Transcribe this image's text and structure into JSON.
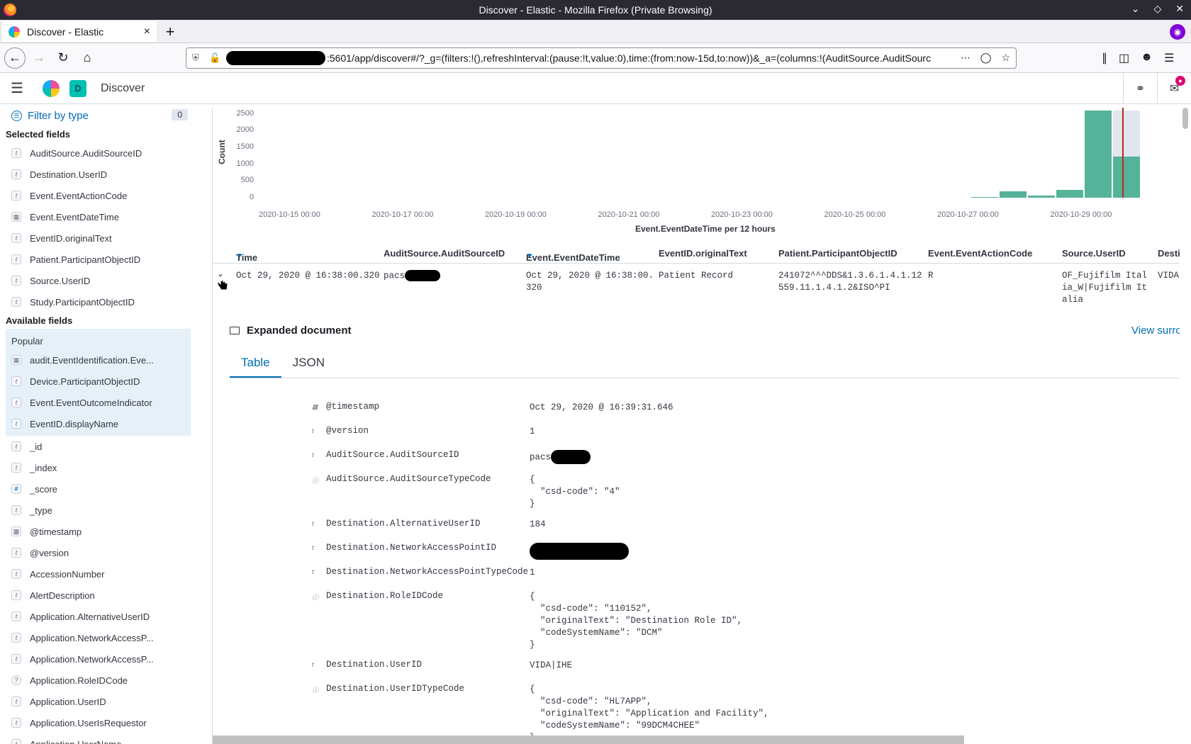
{
  "window": {
    "title": "Discover - Elastic - Mozilla Firefox (Private Browsing)"
  },
  "tab": {
    "label": "Discover - Elastic",
    "close": "×",
    "new": "+"
  },
  "url": {
    "text": ":5601/app/discover#/?_g=(filters:!(),refreshInterval:(pause:!t,value:0),time:(from:now-15d,to:now))&_a=(columns:!(AuditSource.AuditSourc"
  },
  "kibana": {
    "breadcrumb": "Discover",
    "space_letter": "D"
  },
  "sidebar": {
    "filter_label": "Filter by type",
    "filter_count": "0",
    "selected_title": "Selected fields",
    "selected": [
      {
        "type": "t",
        "name": "AuditSource.AuditSourceID"
      },
      {
        "type": "t",
        "name": "Destination.UserID"
      },
      {
        "type": "t",
        "name": "Event.EventActionCode"
      },
      {
        "type": "date",
        "name": "Event.EventDateTime"
      },
      {
        "type": "t",
        "name": "EventID.originalText"
      },
      {
        "type": "t",
        "name": "Patient.ParticipantObjectID"
      },
      {
        "type": "t",
        "name": "Source.UserID"
      },
      {
        "type": "t",
        "name": "Study.ParticipantObjectID"
      }
    ],
    "available_title": "Available fields",
    "popular_label": "Popular",
    "popular": [
      {
        "type": "date",
        "name": "audit.EventIdentification.Eve..."
      },
      {
        "type": "t",
        "name": "Device.ParticipantObjectID"
      },
      {
        "type": "t",
        "name": "Event.EventOutcomeIndicator"
      },
      {
        "type": "t",
        "name": "EventID.displayName"
      }
    ],
    "available": [
      {
        "type": "t",
        "name": "_id"
      },
      {
        "type": "t",
        "name": "_index"
      },
      {
        "type": "num",
        "name": "_score"
      },
      {
        "type": "t",
        "name": "_type"
      },
      {
        "type": "date",
        "name": "@timestamp"
      },
      {
        "type": "t",
        "name": "@version"
      },
      {
        "type": "t",
        "name": "AccessionNumber"
      },
      {
        "type": "t",
        "name": "AlertDescription"
      },
      {
        "type": "t",
        "name": "Application.AlternativeUserID"
      },
      {
        "type": "t",
        "name": "Application.NetworkAccessP..."
      },
      {
        "type": "t",
        "name": "Application.NetworkAccessP..."
      },
      {
        "type": "obj",
        "name": "Application.RoleIDCode"
      },
      {
        "type": "t",
        "name": "Application.UserID"
      },
      {
        "type": "t",
        "name": "Application.UserIsRequestor"
      },
      {
        "type": "t",
        "name": "Application.UserName"
      }
    ]
  },
  "chart_data": {
    "type": "bar",
    "ylabel": "Count",
    "xlabel": "Event.EventDateTime per 12 hours",
    "yticks": [
      "2500",
      "2000",
      "1500",
      "1000",
      "500",
      "0"
    ],
    "xticks": [
      "2020-10-15 00:00",
      "2020-10-17 00:00",
      "2020-10-19 00:00",
      "2020-10-21 00:00",
      "2020-10-23 00:00",
      "2020-10-25 00:00",
      "2020-10-27 00:00",
      "2020-10-29 00:00"
    ],
    "ylim": [
      0,
      2600
    ],
    "categories": [
      "2020-10-27 00:00",
      "2020-10-27 12:00",
      "2020-10-28 00:00",
      "2020-10-28 12:00",
      "2020-10-29 00:00",
      "2020-10-29 12:00"
    ],
    "values": [
      30,
      180,
      70,
      230,
      2600,
      1230
    ]
  },
  "table": {
    "columns": [
      "Time",
      "AuditSource.AuditSourceID",
      "Event.EventDateTime",
      "EventID.originalText",
      "Patient.ParticipantObjectID",
      "Event.EventActionCode",
      "Source.UserID",
      "Desti"
    ],
    "row": {
      "time": "Oct 29, 2020 @ 16:38:00.320",
      "audit_source": "pacs",
      "event_datetime_1": "Oct 29, 2020 @ 16:38:00.",
      "event_datetime_2": "320",
      "event_id_text": "Patient Record",
      "patient_1": "241072^^^DDS&1.3.6.1.4.1.12",
      "patient_2": "559.11.1.4.1.2&ISO^PI",
      "action_code": "R",
      "source_1": "OF_Fujifilm Ital",
      "source_2": "ia_W|Fujifilm It",
      "source_3": "alia",
      "dest": "VIDA"
    }
  },
  "expanded": {
    "title": "Expanded document",
    "view_surrounding": "View surro",
    "tabs": [
      "Table",
      "JSON"
    ],
    "rows": [
      {
        "icon": "date",
        "key": "@timestamp",
        "val": "Oct 29, 2020 @ 16:39:31.646"
      },
      {
        "icon": "t",
        "key": "@version",
        "val": "1"
      },
      {
        "icon": "t",
        "key": "AuditSource.AuditSourceID",
        "val": "pacs"
      },
      {
        "icon": "obj",
        "key": "AuditSource.AuditSourceTypeCode",
        "val": "{\n  \"csd-code\": \"4\"\n}"
      },
      {
        "icon": "t",
        "key": "Destination.AlternativeUserID",
        "val": "184"
      },
      {
        "icon": "t",
        "key": "Destination.NetworkAccessPointID",
        "val": ""
      },
      {
        "icon": "t",
        "key": "Destination.NetworkAccessPointTypeCode",
        "val": "1"
      },
      {
        "icon": "obj",
        "key": "Destination.RoleIDCode",
        "val": "{\n  \"csd-code\": \"110152\",\n  \"originalText\": \"Destination Role ID\",\n  \"codeSystemName\": \"DCM\"\n}"
      },
      {
        "icon": "t",
        "key": "Destination.UserID",
        "val": "VIDA|IHE"
      },
      {
        "icon": "obj",
        "key": "Destination.UserIDTypeCode",
        "val": "{\n  \"csd-code\": \"HL7APP\",\n  \"originalText\": \"Application and Facility\",\n  \"codeSystemName\": \"99DCM4CHEE\"\n}"
      }
    ]
  }
}
